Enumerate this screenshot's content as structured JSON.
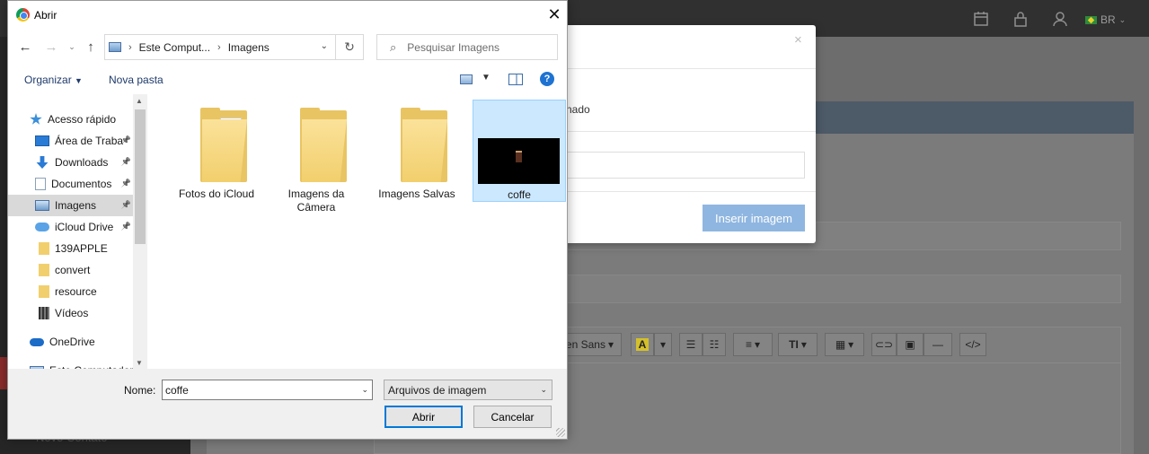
{
  "app": {
    "lang": "BR",
    "sidebar_bottom_text": "Novo Contato",
    "colors": {
      "topbar": "#303030",
      "sidebar": "#262626",
      "primary_button": "#8fb6e0",
      "selection": "#cce8ff"
    }
  },
  "modal": {
    "close": "×",
    "partial_text": "nado",
    "insert_button": "Inserir imagem"
  },
  "editor_toolbar": {
    "font_name_partial": "en Sans",
    "font_name_caret": "▾",
    "text_color_glyph": "A",
    "caret": "▾",
    "text_size_glyph": "T‌I",
    "code_glyph": "</>",
    "hr_glyph": "—"
  },
  "dialog": {
    "title": "Abrir",
    "close": "✕",
    "address": {
      "segment_1": "Este Comput...",
      "segment_2": "Imagens",
      "separator": "›"
    },
    "search_placeholder": "Pesquisar Imagens",
    "toolbar": {
      "organize": "Organizar",
      "new_folder": "Nova pasta"
    },
    "nav_items": [
      {
        "label": "Acesso rápido",
        "icon": "star-icon",
        "pinned": false
      },
      {
        "label": "Área de Traba",
        "icon": "desktop-icon",
        "pinned": true
      },
      {
        "label": "Downloads",
        "icon": "download-icon",
        "pinned": true
      },
      {
        "label": "Documentos",
        "icon": "documents-icon",
        "pinned": true
      },
      {
        "label": "Imagens",
        "icon": "pictures-icon",
        "pinned": true,
        "selected": true
      },
      {
        "label": "iCloud Drive",
        "icon": "icloud-icon",
        "pinned": true
      },
      {
        "label": "139APPLE",
        "icon": "folder-icon",
        "pinned": false
      },
      {
        "label": "convert",
        "icon": "folder-icon",
        "pinned": false
      },
      {
        "label": "resource",
        "icon": "folder-icon",
        "pinned": false
      },
      {
        "label": "Vídeos",
        "icon": "videos-icon",
        "pinned": false
      },
      {
        "label": "OneDrive",
        "icon": "onedrive-icon",
        "pinned": false
      },
      {
        "label": "Este Computador",
        "icon": "computer-icon",
        "pinned": false
      }
    ],
    "files": [
      {
        "label": "Fotos do iCloud",
        "kind": "folder-with-docs"
      },
      {
        "label": "Imagens da Câmera",
        "kind": "folder"
      },
      {
        "label": "Imagens Salvas",
        "kind": "folder"
      },
      {
        "label": "coffe",
        "kind": "image",
        "selected": true
      }
    ],
    "name_label": "Nome:",
    "name_value": "coffe",
    "file_type": "Arquivos de imagem",
    "open_button": "Abrir",
    "cancel_button": "Cancelar"
  }
}
